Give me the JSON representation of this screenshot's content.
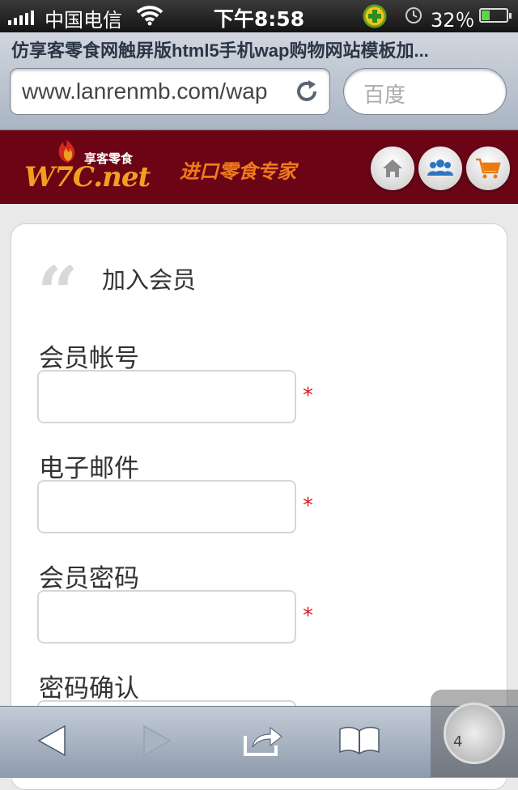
{
  "status_bar": {
    "carrier": "中国电信",
    "time": "下午8:58",
    "battery_percent": "32％",
    "battery_level": 0.32
  },
  "browser": {
    "page_title": "仿享客零食网触屏版html5手机wap购物网站模板加...",
    "url": "www.lanrenmb.com/wap",
    "search_placeholder": "百度",
    "tab_count": "4"
  },
  "site": {
    "logo_cn": "享客零食",
    "logo_main": "W7C.net",
    "slogan": "进口零食专家"
  },
  "form": {
    "title": "加入会员",
    "fields": [
      {
        "label": "会员帐号",
        "value": "",
        "required_mark": "*"
      },
      {
        "label": "电子邮件",
        "value": "",
        "required_mark": "*"
      },
      {
        "label": "会员密码",
        "value": "",
        "required_mark": "*"
      },
      {
        "label": "密码确认",
        "value": ""
      }
    ]
  },
  "icons": {
    "home": "home-icon",
    "members": "users-icon",
    "cart": "cart-icon"
  },
  "colors": {
    "header_bg": "#6b0516",
    "slogan": "#f07c19",
    "logo": "#f0a020",
    "required": "#e0141e"
  }
}
